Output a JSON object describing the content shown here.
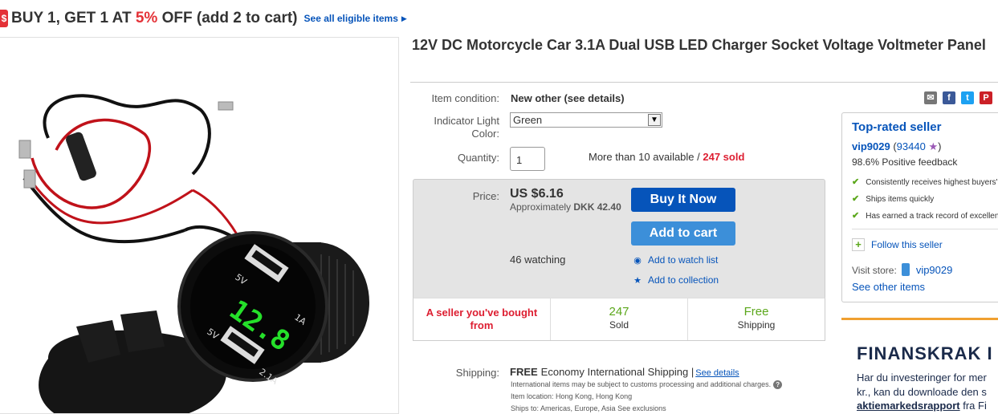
{
  "promo": {
    "icon": "$",
    "prefix": "BUY 1, GET 1 AT ",
    "percent": "5%",
    "suffix": " OFF (add 2 to cart)",
    "link": "See all eligible items"
  },
  "product": {
    "title": "12V DC Motorcycle Car 3.1A Dual USB LED Charger Socket Voltage Voltmeter Panel",
    "display_reading": "12.8",
    "port_labels": [
      "5V",
      "1A",
      "5V",
      "2.1A"
    ]
  },
  "details": {
    "condition_label": "Item condition:",
    "condition_value": "New other (see details)",
    "light_label": "Indicator Light Color:",
    "light_value": "Green",
    "quantity_label": "Quantity:",
    "quantity_value": "1",
    "availability": "More than 10 available / ",
    "sold": "247 sold"
  },
  "price": {
    "label": "Price:",
    "value": "US $6.16",
    "approx_prefix": "Approximately ",
    "approx_value": "DKK 42.40",
    "buy_now": "Buy It Now",
    "add_to_cart": "Add to cart",
    "watching": "46 watching",
    "watch_link": "Add to watch list",
    "collection_link": "Add to collection"
  },
  "stats": {
    "seller_note": "A seller you've bought from",
    "sold_count": "247",
    "sold_label": "Sold",
    "shipping_big": "Free",
    "shipping_label": "Shipping"
  },
  "shipping": {
    "label": "Shipping:",
    "free": "FREE",
    "method": "Economy International Shipping |",
    "details_link": "See details",
    "note": "International items may be subject to customs processing and additional charges.",
    "location": "Item location:  Hong Kong, Hong Kong",
    "ships_to": "Ships to:  Americas, Europe, Asia   See exclusions"
  },
  "seller": {
    "badge": "Top-rated seller",
    "name": "vip9029",
    "score": "93440",
    "feedback": "98.6% Positive feedback",
    "checks": [
      "Consistently receives highest buyers' ratings",
      "Ships items quickly",
      "Has earned a track record of excellent service"
    ],
    "follow": "Follow this seller",
    "visit_label": "Visit store:",
    "store_name": "vip9029",
    "other_items": "See other items"
  },
  "ad": {
    "headline": "FINANSKRAK I",
    "line1": "Har du investeringer for mer",
    "line2": "kr., kan du downloade den s",
    "line3_bold": "aktiemarkedsrapport",
    "line3_rest": " fra Fi"
  },
  "colors": {
    "link": "#0654ba",
    "buy_button": "#0654ba",
    "cart_button": "#3c8fd9",
    "sale_red": "#dd1e31",
    "green": "#5ba71b",
    "price_panel": "#e4e4e4"
  }
}
